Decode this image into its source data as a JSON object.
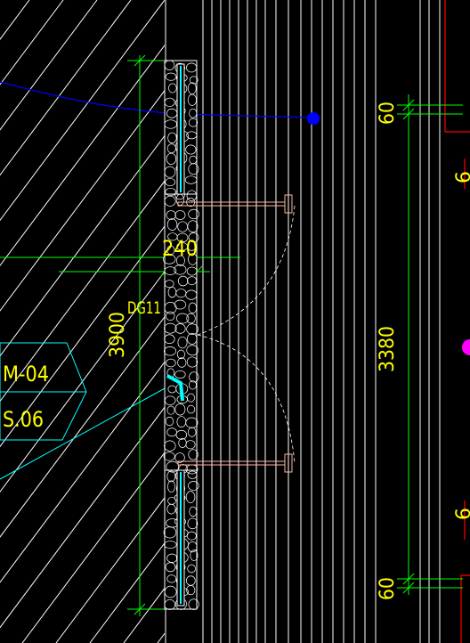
{
  "drawing": {
    "background": "#000000",
    "colors": {
      "hatch": "#ffffff",
      "wall": "#ffffff",
      "glass": "#00ffff",
      "dimension": "#00ff00",
      "text": "#ffff00",
      "leader": "#00ffff",
      "grid_line": "#0000ff",
      "door_arc": "#ffffff",
      "door_leaf": "#ffb6a0",
      "border": "#ff0000",
      "marker_blue": "#0000ff",
      "marker_magenta": "#ff00ff"
    },
    "labels": {
      "dim_wall": "240",
      "dim_height": "3900",
      "door_code": "DG11",
      "tag_line1": "M-04",
      "tag_line2": "S.06",
      "dim_opening": "3380",
      "dim_top_offset": "60",
      "dim_bottom_offset": "60",
      "dim_edge_top": "6",
      "dim_edge_bottom": "6"
    }
  }
}
